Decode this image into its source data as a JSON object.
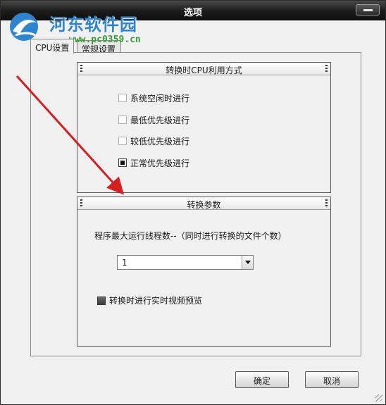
{
  "window": {
    "title": "选项"
  },
  "watermark": {
    "site": "河东软件园",
    "url": "www.pc0359.cn"
  },
  "tabs": [
    {
      "label": "CPU设置",
      "active": true
    },
    {
      "label": "常规设置",
      "active": false
    }
  ],
  "cpu_group": {
    "title": "转换时CPU利用方式",
    "options": [
      {
        "label": "系统空闲时进行",
        "checked": false
      },
      {
        "label": "最低优先级进行",
        "checked": false
      },
      {
        "label": "较低优先级进行",
        "checked": false
      },
      {
        "label": "正常优先级进行",
        "checked": true
      }
    ]
  },
  "conv_group": {
    "title": "转换参数",
    "threads_label": "程序最大运行线程数--（同时进行转换的文件个数）",
    "threads_value": "1",
    "preview_label": "转换时进行实时视频预览"
  },
  "buttons": {
    "ok": "确定",
    "cancel": "取消"
  },
  "colors": {
    "arrow": "#d42020",
    "watermark_site": "#2f84d0",
    "watermark_url": "#3b9a3b"
  }
}
